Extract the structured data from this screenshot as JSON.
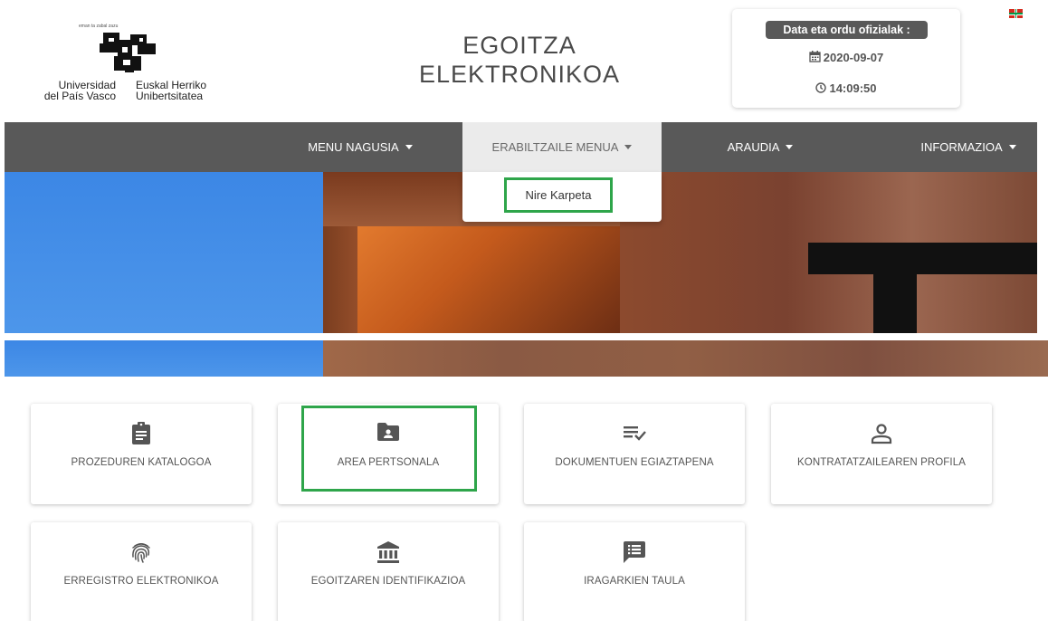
{
  "header": {
    "logo": {
      "motto": "eman ta zabal zazu",
      "university_es_line1": "Universidad",
      "university_es_line2": "del País Vasco",
      "university_eu_line1": "Euskal Herriko",
      "university_eu_line2": "Unibertsitatea"
    },
    "title_line1": "EGOITZA",
    "title_line2": "ELEKTRONIKOA",
    "official_time": {
      "badge": "Data eta ordu ofizialak :",
      "date": "2020-09-07",
      "time": "14:09:50",
      "date_icon": "calendar-icon",
      "time_icon": "clock-icon"
    },
    "language_flag": "ikurrina-flag-icon"
  },
  "nav": {
    "items": [
      {
        "label": "MENU NAGUSIA"
      },
      {
        "label": "ERABILTZAILE MENUA"
      },
      {
        "label": "ARAUDIA"
      },
      {
        "label": "INFORMAZIOA"
      }
    ],
    "open_dropdown": {
      "items": [
        {
          "label": "Nire Karpeta"
        }
      ]
    }
  },
  "cards": [
    {
      "label": "PROZEDUREN KATALOGOA",
      "icon": "clipboard-icon"
    },
    {
      "label": "AREA PERTSONALA",
      "icon": "folder-account-icon"
    },
    {
      "label": "DOKUMENTUEN EGIAZTAPENA",
      "icon": "list-check-icon"
    },
    {
      "label": "KONTRATATZAILEAREN PROFILA",
      "icon": "person-icon"
    },
    {
      "label": "ERREGISTRO ELEKTRONIKOA",
      "icon": "fingerprint-icon"
    },
    {
      "label": "EGOITZAREN IDENTIFIKAZIOA",
      "icon": "bank-icon"
    },
    {
      "label": "IRAGARKIEN TAULA",
      "icon": "message-list-icon"
    }
  ],
  "colors": {
    "navbar": "#595959",
    "active_nav": "#ebebeb",
    "highlight": "#2ea54a",
    "icon": "#555555"
  }
}
